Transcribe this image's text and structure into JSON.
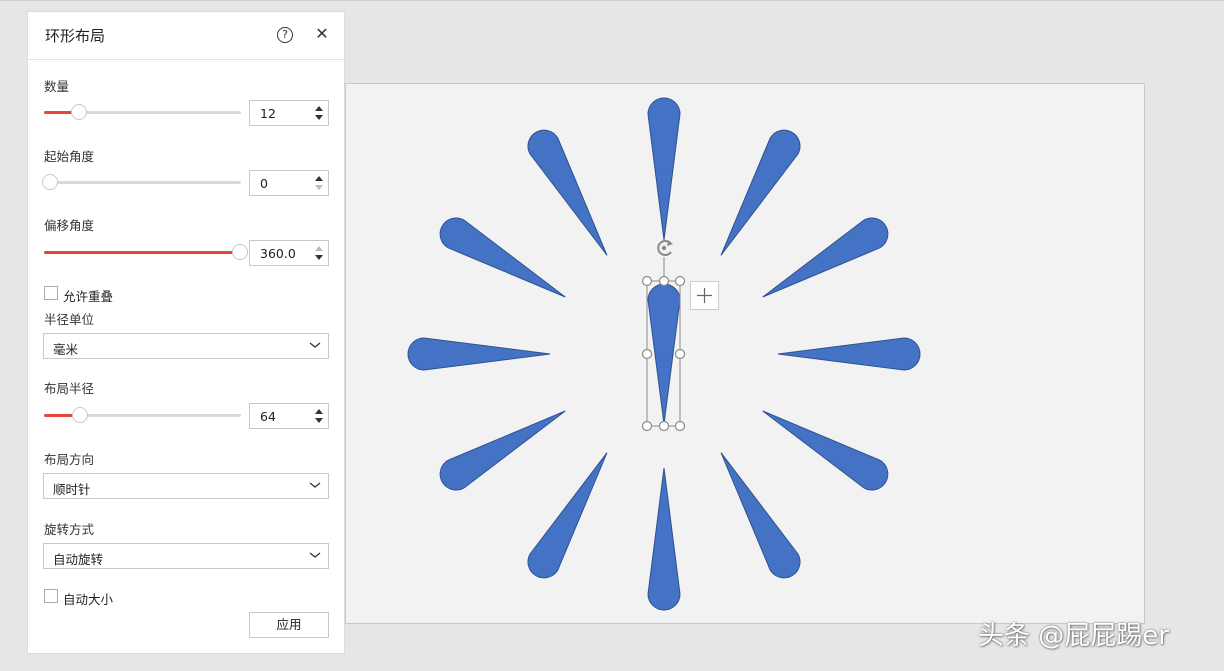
{
  "panel": {
    "title": "环形布局",
    "help_symbol": "?",
    "close_symbol": "✕",
    "count": {
      "label": "数量",
      "value": "12",
      "slider_fraction": 0.15
    },
    "start_angle": {
      "label": "起始角度",
      "value": "0",
      "slider_fraction": 0.0
    },
    "offset_angle": {
      "label": "偏移角度",
      "value": "360.0",
      "slider_fraction": 1.0
    },
    "allow_overlap": {
      "label": "允许重叠",
      "checked": false
    },
    "radius_unit": {
      "label": "半径单位",
      "value": "毫米"
    },
    "layout_radius": {
      "label": "布局半径",
      "value": "64",
      "slider_fraction": 0.16
    },
    "layout_direction": {
      "label": "布局方向",
      "value": "顺时针"
    },
    "rotation_mode": {
      "label": "旋转方式",
      "value": "自动旋转"
    },
    "auto_size": {
      "label": "自动大小",
      "checked": false
    },
    "apply_label": "应用"
  },
  "canvas": {
    "shape_color": "#4472c4",
    "shape_outline": "#2f528f",
    "shape_count": 12,
    "selection_handle_color": "#8a8a8a",
    "rotate_icon": "rotate-handle-icon",
    "add_icon": "plus-icon"
  },
  "watermark": "头条 @屁屁踢er",
  "colors": {
    "accent": "#e8443a",
    "background": "#e6e6e6"
  }
}
